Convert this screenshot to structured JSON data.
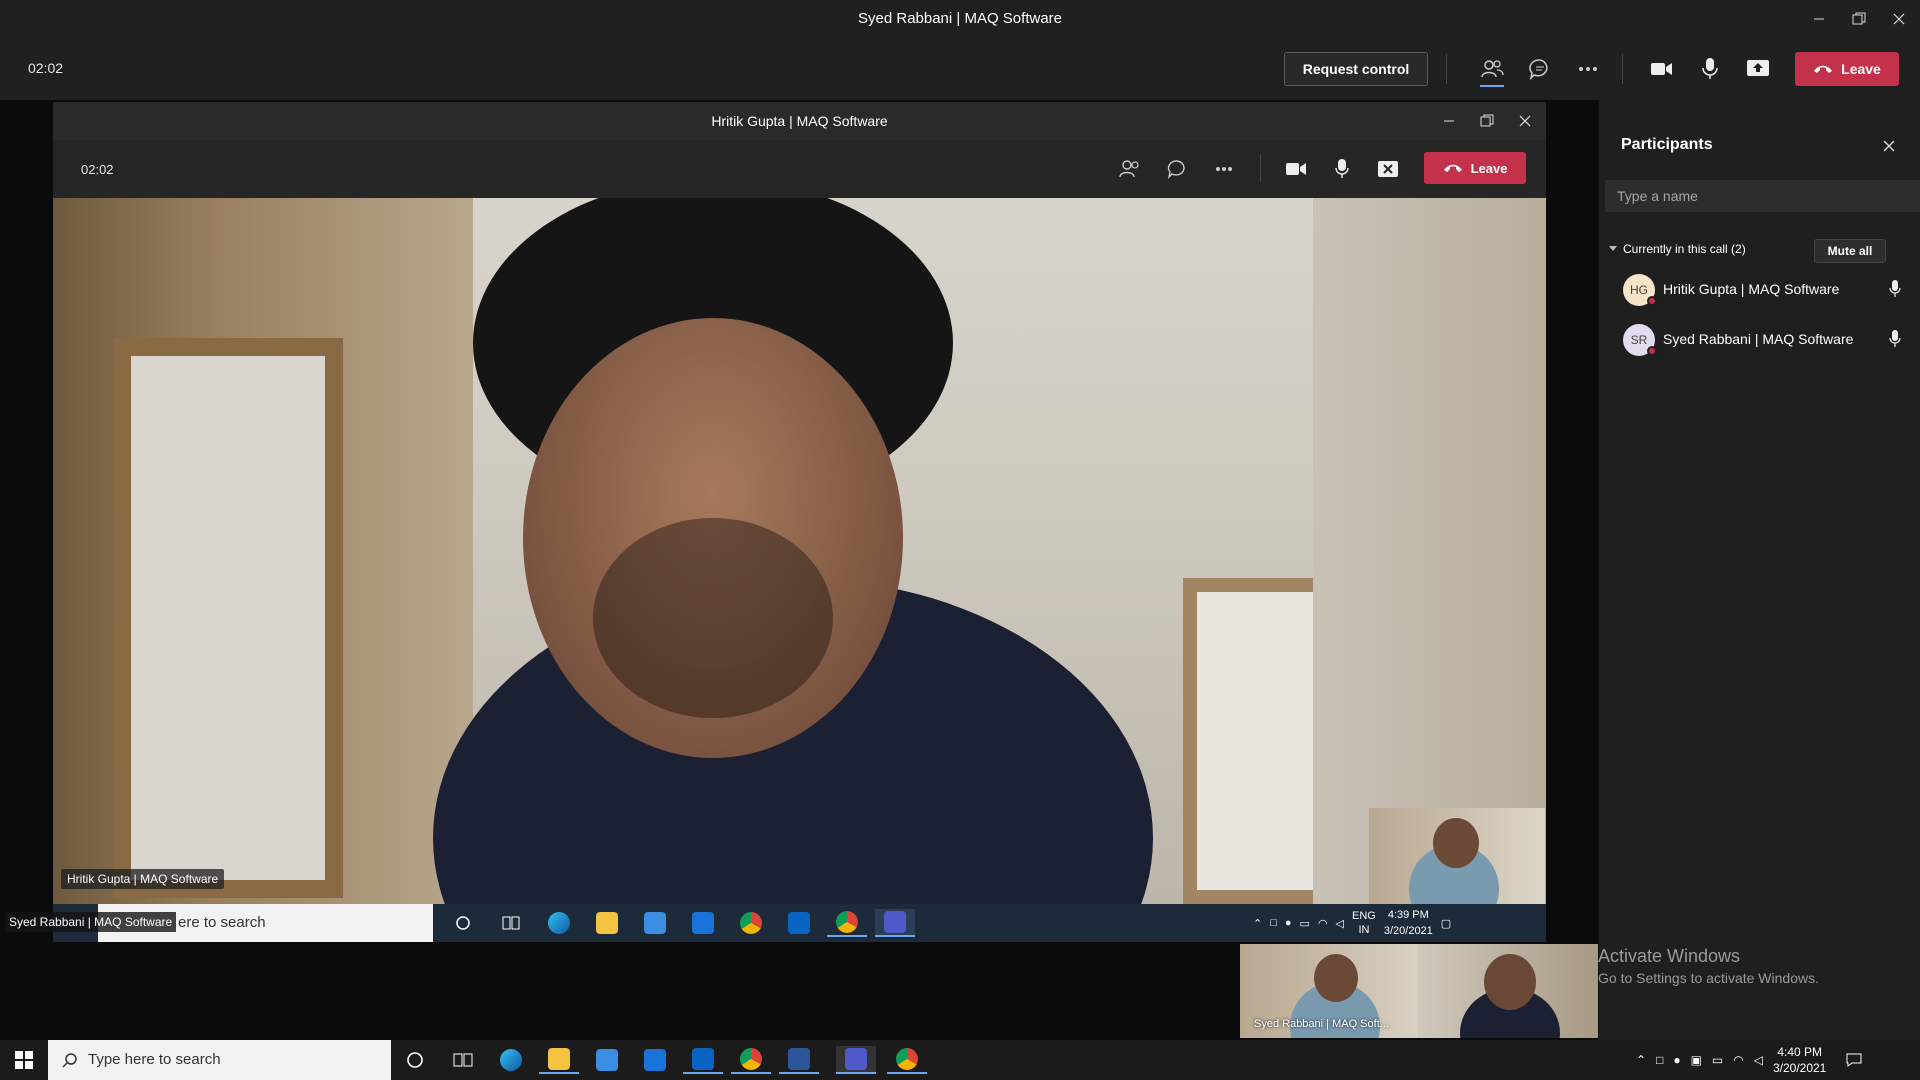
{
  "outer_window": {
    "title": "Syed Rabbani | MAQ Software",
    "timer": "02:02",
    "request_control_label": "Request control",
    "leave_label": "Leave"
  },
  "inner_window": {
    "title": "Hritik Gupta | MAQ Software",
    "timer": "02:02",
    "leave_label": "Leave",
    "main_video_name": "Hritik Gupta | MAQ Software",
    "taskbar_search_placeholder": "ere to search",
    "taskbar_overlay_name": "Syed Rabbani | MAQ Software",
    "tray_lang": "ENG",
    "tray_region": "IN",
    "tray_time": "4:39 PM",
    "tray_date": "3/20/2021"
  },
  "participants_panel": {
    "title": "Participants",
    "search_placeholder": "Type a name",
    "section_heading": "Currently in this call (2)",
    "mute_all_label": "Mute all",
    "participants": [
      {
        "initials": "HG",
        "name": "Hritik Gupta | MAQ Software"
      },
      {
        "initials": "SR",
        "name": "Syed Rabbani | MAQ Software"
      }
    ]
  },
  "self_thumbnail_name": "Syed Rabbani | MAQ Soft...",
  "activate_windows": {
    "title": "Activate Windows",
    "subtitle": "Go to Settings to activate Windows."
  },
  "taskbar": {
    "search_placeholder": "Type here to search",
    "time": "4:40 PM",
    "date": "3/20/2021"
  },
  "colors": {
    "leave_red": "#c4314b",
    "background": "#1f1f1f",
    "accent_blue": "#6aa8f0"
  }
}
